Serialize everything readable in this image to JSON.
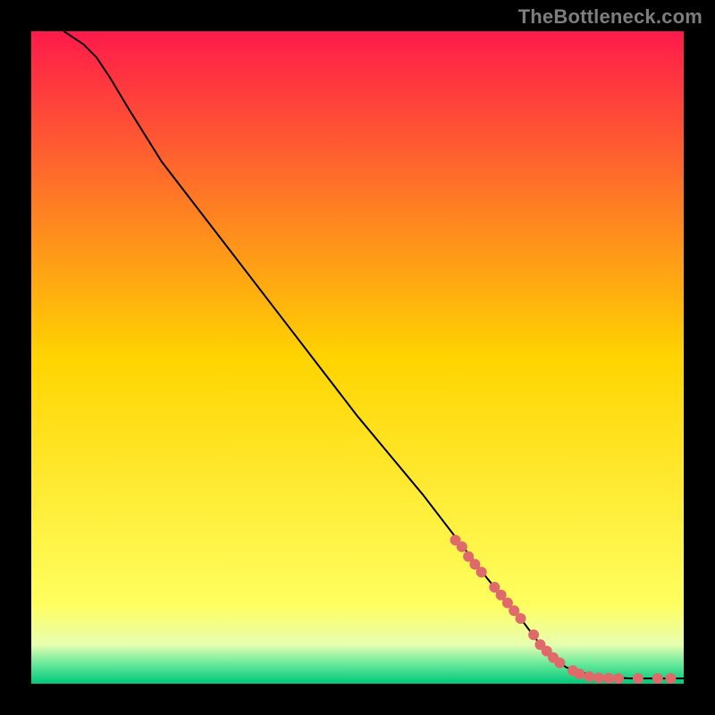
{
  "watermark": "TheBottleneck.com",
  "chart_data": {
    "type": "line",
    "title": "",
    "xlabel": "",
    "ylabel": "",
    "xlim": [
      0,
      100
    ],
    "ylim": [
      0,
      100
    ],
    "grid": false,
    "legend": false,
    "background_gradient": {
      "stops": [
        {
          "pos": 0.0,
          "color": "#ff1a4b"
        },
        {
          "pos": 0.5,
          "color": "#ffd400"
        },
        {
          "pos": 0.88,
          "color": "#ffff60"
        },
        {
          "pos": 0.94,
          "color": "#e8ffb0"
        },
        {
          "pos": 0.97,
          "color": "#66e89a"
        },
        {
          "pos": 1.0,
          "color": "#00c97a"
        }
      ]
    },
    "series": [
      {
        "name": "curve",
        "color": "#000000",
        "x": [
          5,
          8,
          10,
          12,
          15,
          20,
          30,
          40,
          50,
          60,
          70,
          75,
          78,
          80,
          82,
          84,
          86,
          88,
          90,
          92,
          94,
          96,
          98,
          100
        ],
        "y": [
          100,
          98,
          96,
          93,
          88,
          80,
          67,
          54,
          41,
          29,
          16,
          10,
          6,
          4,
          2.5,
          1.8,
          1.3,
          1.0,
          0.9,
          0.8,
          0.8,
          0.8,
          0.8,
          0.8
        ]
      }
    ],
    "markers": {
      "name": "highlighted-points",
      "color": "#e06a6a",
      "radius": 6,
      "points": [
        {
          "x": 65,
          "y": 22
        },
        {
          "x": 66,
          "y": 21
        },
        {
          "x": 67,
          "y": 19.5
        },
        {
          "x": 68,
          "y": 18.3
        },
        {
          "x": 69,
          "y": 17.1
        },
        {
          "x": 71,
          "y": 14.8
        },
        {
          "x": 72,
          "y": 13.6
        },
        {
          "x": 73,
          "y": 12.4
        },
        {
          "x": 74,
          "y": 11.2
        },
        {
          "x": 75,
          "y": 10
        },
        {
          "x": 77,
          "y": 7.5
        },
        {
          "x": 78,
          "y": 6
        },
        {
          "x": 79,
          "y": 5
        },
        {
          "x": 80,
          "y": 4
        },
        {
          "x": 81,
          "y": 3.2
        },
        {
          "x": 83,
          "y": 2
        },
        {
          "x": 84,
          "y": 1.5
        },
        {
          "x": 85.5,
          "y": 1.1
        },
        {
          "x": 87,
          "y": 0.9
        },
        {
          "x": 88.5,
          "y": 0.85
        },
        {
          "x": 90,
          "y": 0.8
        },
        {
          "x": 93,
          "y": 0.8
        },
        {
          "x": 96,
          "y": 0.8
        },
        {
          "x": 98,
          "y": 0.8
        }
      ]
    }
  }
}
